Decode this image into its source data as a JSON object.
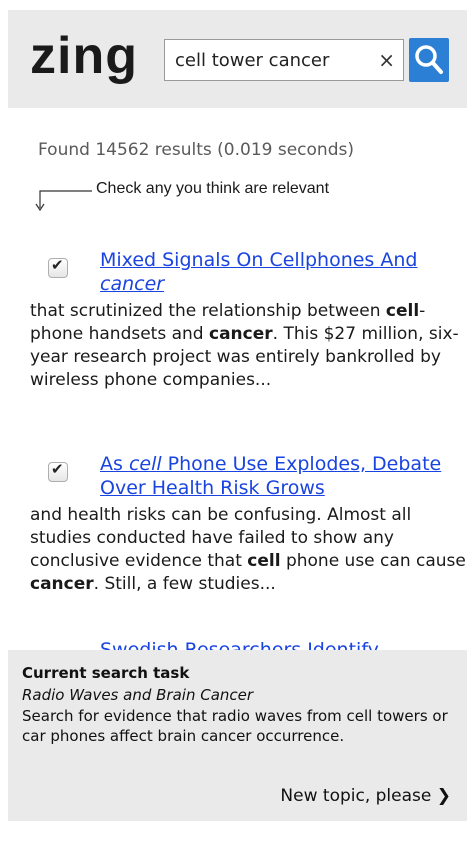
{
  "header": {
    "logo": "zing",
    "search_value": "cell tower cancer",
    "clear_glyph": "×"
  },
  "results": {
    "count_text": "Found 14562 results (0.019 seconds)",
    "hint_text": "Check any you think are relevant",
    "items": [
      {
        "checked": true,
        "title_parts": [
          "Mixed Signals On Cellphones And ",
          "cancer"
        ],
        "snippet_parts": [
          "that scrutinized the relationship between ",
          "cell",
          "-phone handsets and ",
          "cancer",
          ". This $27 million, six-year research project was entirely bankrolled by wireless phone companies..."
        ]
      },
      {
        "checked": true,
        "title_parts": [
          "As ",
          "cell",
          " Phone Use Explodes, Debate Over Health Risk Grows"
        ],
        "snippet_parts": [
          "and health risks can be confusing. Almost all studies conducted have failed to show any conclusive evidence that ",
          "cell",
          " phone use can cause ",
          "cancer",
          ". Still, a few studies..."
        ]
      }
    ],
    "cutoff_title": "Swedish Researchers Identify"
  },
  "task": {
    "heading": "Current search task",
    "title": "Radio Waves and Brain Cancer",
    "description": "Search for evidence that radio waves from cell towers or car phones affect brain cancer occurrence.",
    "new_topic_label": "New topic, please ❯"
  },
  "colors": {
    "link": "#1a44e0",
    "panel_bg": "#eaeaea",
    "search_button": "#2b7fd4"
  }
}
